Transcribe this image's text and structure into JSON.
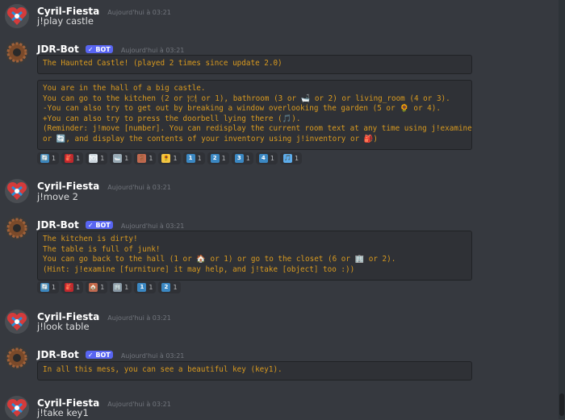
{
  "messages": [
    {
      "author": "Cyril-Fiesta",
      "time": "Aujourd'hui à 03:21",
      "text": "j!play castle"
    },
    {
      "author": "JDR-Bot",
      "badge": "✓ BOT",
      "time": "Aujourd'hui à 03:21",
      "title_block": "The Haunted Castle! (played 2 times since update 2.0)",
      "body_lines": [
        "You are in the hall of a big castle.",
        "You can go to the kitchen (2 or 🍽 or 1), bathroom (3 or 🛁 or 2) or living_room (4 or 3).",
        "-You can also try to get out by breaking a window overlooking the garden (5 or 🌻 or 4).",
        "+You can also try to press the doorbell lying there (🎵).",
        "(Reminder: j!move [number]. You can redisplay the current room text at any time using j!examine",
        "or 🔄, and display the contents of your inventory using j!inventory or 🎒)"
      ],
      "reactions": [
        {
          "icon": "🔄",
          "count": "1"
        },
        {
          "icon": "🎒",
          "count": "1"
        },
        {
          "icon": "🍽",
          "count": "1"
        },
        {
          "icon": "🛁",
          "count": "1"
        },
        {
          "icon": "🚪",
          "count": "1"
        },
        {
          "icon": "🌻",
          "count": "1"
        },
        {
          "icon": "1",
          "count": "1"
        },
        {
          "icon": "2",
          "count": "1"
        },
        {
          "icon": "3",
          "count": "1"
        },
        {
          "icon": "4",
          "count": "1"
        },
        {
          "icon": "🎵",
          "count": "1"
        }
      ]
    },
    {
      "author": "Cyril-Fiesta",
      "time": "Aujourd'hui à 03:21",
      "text": "j!move 2"
    },
    {
      "author": "JDR-Bot",
      "badge": "✓ BOT",
      "time": "Aujourd'hui à 03:21",
      "body_lines": [
        "The kitchen is dirty!",
        "The table is full of junk!",
        "You can go back to the hall (1 or 🏠 or 1) or go to the closet (6 or 🏢 or 2).",
        "(Hint: j!examine [furniture] it may help, and j!take [object] too :))"
      ],
      "reactions": [
        {
          "icon": "🔄",
          "count": "1"
        },
        {
          "icon": "🎒",
          "count": "1"
        },
        {
          "icon": "🏠",
          "count": "1"
        },
        {
          "icon": "🏢",
          "count": "1"
        },
        {
          "icon": "1",
          "count": "1"
        },
        {
          "icon": "2",
          "count": "1"
        }
      ]
    },
    {
      "author": "Cyril-Fiesta",
      "time": "Aujourd'hui à 03:21",
      "text": "j!look table"
    },
    {
      "author": "JDR-Bot",
      "badge": "✓ BOT",
      "time": "Aujourd'hui à 03:21",
      "body_lines": [
        "In all this mess, you can see a beautiful key (key1)."
      ]
    },
    {
      "author": "Cyril-Fiesta",
      "time": "Aujourd'hui à 03:21",
      "text": "j!take key1"
    }
  ],
  "colors": {
    "background": "#36393f",
    "code_text": "#d99a1f",
    "bot_badge": "#5865f2",
    "keycap": "#3b88c3"
  }
}
